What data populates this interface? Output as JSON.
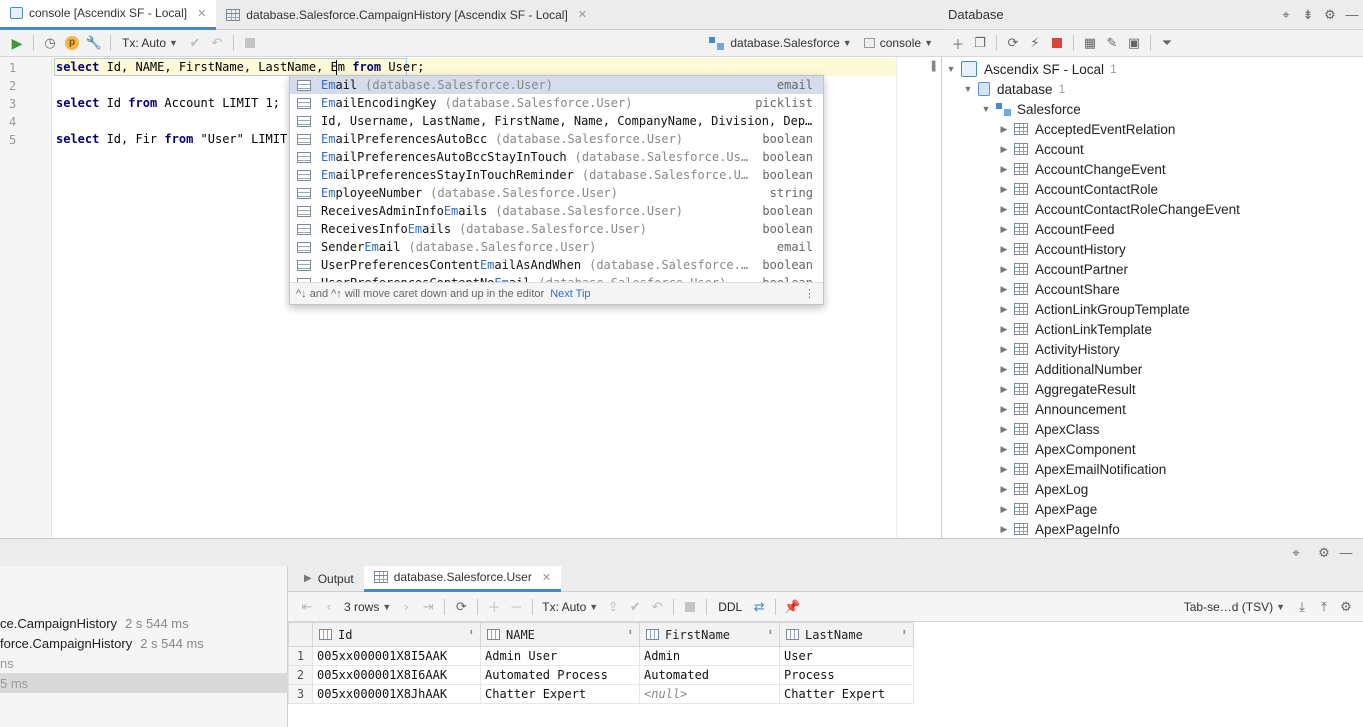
{
  "editor_tabs": [
    {
      "label": "console [Ascendix SF - Local]",
      "active": true
    },
    {
      "label": "database.Salesforce.CampaignHistory [Ascendix SF - Local]",
      "active": false
    }
  ],
  "editor_toolbar": {
    "tx_label": "Tx: Auto",
    "schema_label": "database.Salesforce",
    "console_label": "console"
  },
  "editor": {
    "line_numbers": [
      "1",
      "2",
      "3",
      "4",
      "5"
    ],
    "lines": [
      {
        "k1": "select",
        "t1": " Id, NAME, FirstName, LastName, Em ",
        "k2": "from",
        "t2": " User;"
      },
      {
        "k1": "select",
        "t1": " Id ",
        "k2": "from",
        "t2": " Account LIMIT 1;"
      },
      {
        "k1": "select",
        "t1": " Id, Fir ",
        "k2": "from",
        "t2": " \"User\" LIMIT 1"
      }
    ]
  },
  "autocomplete": {
    "items": [
      {
        "pre": "",
        "hl": "Em",
        "post": "ail",
        "ctx": "(database.Salesforce.User)",
        "type": "email"
      },
      {
        "pre": "",
        "hl": "Em",
        "post": "ailEncodingKey",
        "ctx": "(database.Salesforce.User)",
        "type": "picklist"
      },
      {
        "pre": "Id, Username, LastName, FirstName, Name, CompanyName, Division, Dep…",
        "hl": "",
        "post": "",
        "ctx": "",
        "type": ""
      },
      {
        "pre": "",
        "hl": "Em",
        "post": "ailPreferencesAutoBcc",
        "ctx": "(database.Salesforce.User)",
        "type": "boolean"
      },
      {
        "pre": "",
        "hl": "Em",
        "post": "ailPreferencesAutoBccStayInTouch",
        "ctx": "(database.Salesforce.Use…",
        "type": "boolean"
      },
      {
        "pre": "",
        "hl": "Em",
        "post": "ailPreferencesStayInTouchReminder",
        "ctx": "(database.Salesforce.Us…",
        "type": "boolean"
      },
      {
        "pre": "",
        "hl": "Em",
        "post": "ployeeNumber",
        "ctx": "(database.Salesforce.User)",
        "type": "string"
      },
      {
        "pre": "ReceivesAdminInfo",
        "hl": "Em",
        "post": "ails",
        "ctx": "(database.Salesforce.User)",
        "type": "boolean"
      },
      {
        "pre": "ReceivesInfo",
        "hl": "Em",
        "post": "ails",
        "ctx": "(database.Salesforce.User)",
        "type": "boolean"
      },
      {
        "pre": "Sender",
        "hl": "Em",
        "post": "ail",
        "ctx": "(database.Salesforce.User)",
        "type": "email"
      },
      {
        "pre": "UserPreferencesContent",
        "hl": "Em",
        "post": "ailAsAndWhen",
        "ctx": "(database.Salesforce.U…",
        "type": "boolean"
      },
      {
        "pre": "UserPreferencesContentNo",
        "hl": "Em",
        "post": "ail",
        "ctx": "(database.Salesforce.User)",
        "type": "boolean"
      }
    ],
    "footer_hint": "^↓ and ^↑ will move caret down and up in the editor",
    "footer_link": "Next Tip"
  },
  "database_panel": {
    "title": "Database",
    "datasource": {
      "label": "Ascendix SF - Local",
      "count": "1"
    },
    "database": {
      "label": "database",
      "count": "1"
    },
    "schema": "Salesforce",
    "tables": [
      "AcceptedEventRelation",
      "Account",
      "AccountChangeEvent",
      "AccountContactRole",
      "AccountContactRoleChangeEvent",
      "AccountFeed",
      "AccountHistory",
      "AccountPartner",
      "AccountShare",
      "ActionLinkGroupTemplate",
      "ActionLinkTemplate",
      "ActivityHistory",
      "AdditionalNumber",
      "AggregateResult",
      "Announcement",
      "ApexClass",
      "ApexComponent",
      "ApexEmailNotification",
      "ApexLog",
      "ApexPage",
      "ApexPageInfo"
    ]
  },
  "history": [
    {
      "label": "ce.CampaignHistory",
      "dur": "2 s 544 ms"
    },
    {
      "label": "force.CampaignHistory",
      "dur": "2 s 544 ms"
    },
    {
      "label": "ns",
      "dur": ""
    },
    {
      "label": "5 ms",
      "dur": ""
    }
  ],
  "results": {
    "tabs": [
      {
        "label": "Output",
        "active": false
      },
      {
        "label": "database.Salesforce.User",
        "active": true
      }
    ],
    "rows_label": "3 rows",
    "tx_label": "Tx: Auto",
    "ddl_label": "DDL",
    "export_label": "Tab-se…d (TSV)",
    "columns": [
      "Id",
      "NAME",
      "FirstName",
      "LastName"
    ],
    "rows": [
      {
        "n": "1",
        "id": "005xx000001X8I5AAK",
        "name": "Admin User",
        "first": "Admin",
        "last": "User"
      },
      {
        "n": "2",
        "id": "005xx000001X8I6AAK",
        "name": "Automated Process",
        "first": "Automated",
        "last": "Process"
      },
      {
        "n": "3",
        "id": "005xx000001X8JhAAK",
        "name": "Chatter Expert",
        "first": "<null>",
        "last": "Chatter Expert"
      }
    ]
  }
}
